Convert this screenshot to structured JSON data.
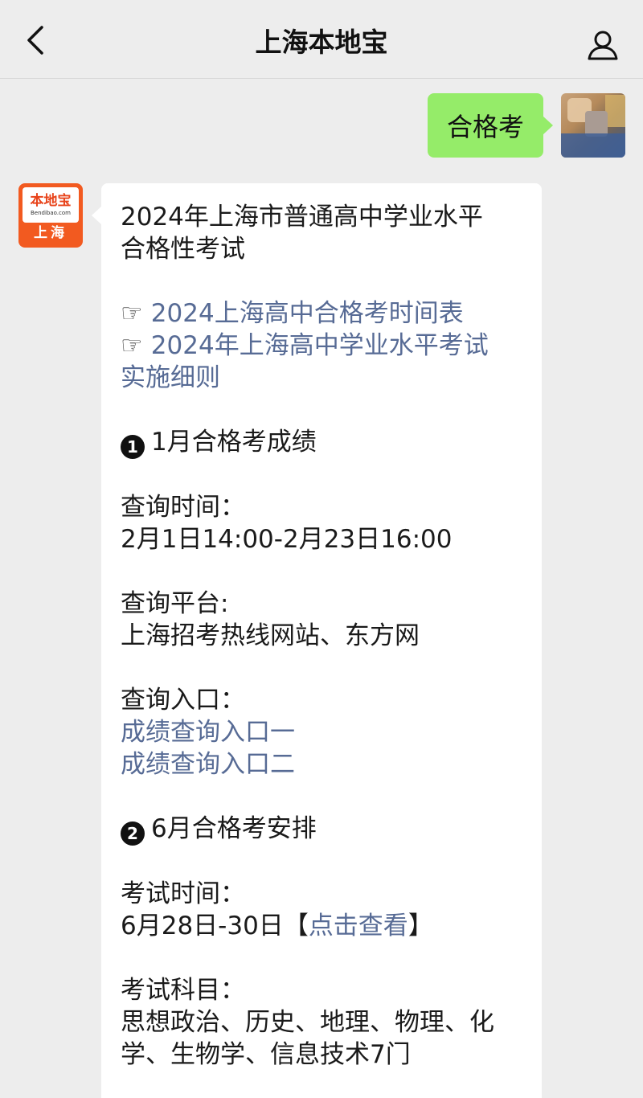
{
  "header": {
    "title": "上海本地宝",
    "back_icon": "chevron-left-icon",
    "profile_icon": "person-icon"
  },
  "user_message": {
    "text": "合格考"
  },
  "bot": {
    "avatar": {
      "logo_text": "本地宝",
      "logo_url": "Bendibao.com",
      "city": "上海"
    },
    "title_lines": [
      "2024年上海市普通高中学业水平",
      "合格性考试"
    ],
    "links": {
      "hand_icon": "☞",
      "link1": "2024上海高中合格考时间表",
      "link2_line1": "2024年上海高中学业水平考试",
      "link2_line2": "实施细则"
    },
    "section1": {
      "badge": "1",
      "heading": "1月合格考成绩",
      "time_label": "查询时间：",
      "time_value": "2月1日14:00-2月23日16:00",
      "platform_label": "查询平台:",
      "platform_value": "上海招考热线网站、东方网",
      "entry_label": "查询入口：",
      "entry_link1": "成绩查询入口一",
      "entry_link2": "成绩查询入口二"
    },
    "section2": {
      "badge": "2",
      "heading": "6月合格考安排",
      "time_label": "考试时间：",
      "time_value": "6月28日-30日",
      "bracket_open": "【",
      "time_link": "点击查看",
      "bracket_close": "】",
      "subjects_label": "考试科目：",
      "subjects_line1": "思想政治、历史、地理、物理、化",
      "subjects_line2": "学、生物学、信息技术7门"
    }
  },
  "colors": {
    "background": "#ededed",
    "user_bubble": "#95ec69",
    "bot_bubble": "#ffffff",
    "link": "#576b95",
    "brand_orange": "#f25a20"
  }
}
